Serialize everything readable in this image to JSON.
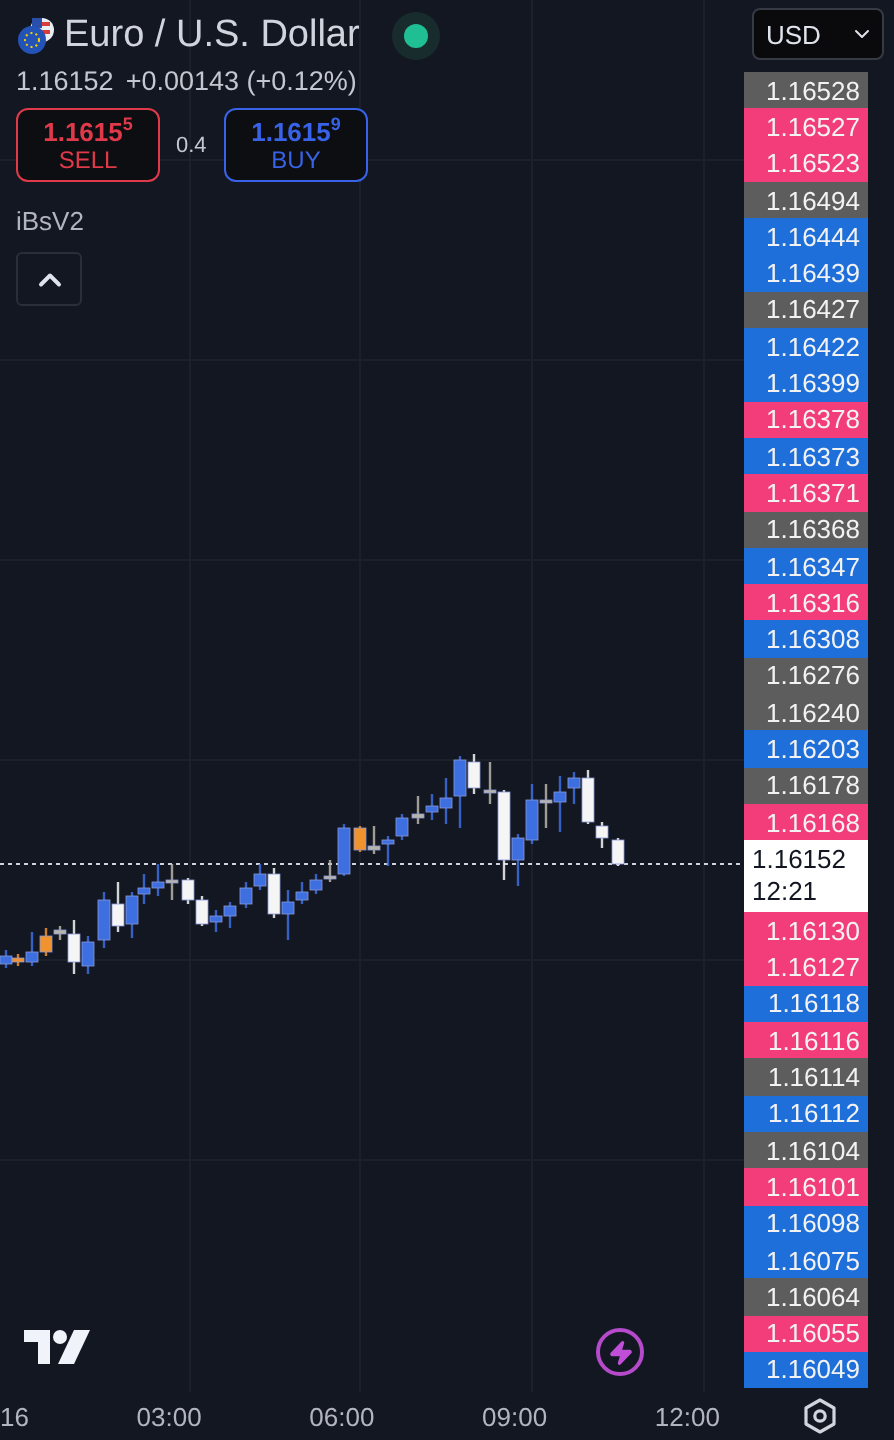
{
  "header": {
    "title": "Euro / U.S. Dollar",
    "last": "1.16152",
    "change": "+0.00143 (+0.12%)"
  },
  "trade": {
    "sell": {
      "price": "1.1615$^{5}$",
      "label": "SELL"
    },
    "spread": "0.4",
    "buy": {
      "price": "1.1615$^{9}$",
      "label": "BUY"
    }
  },
  "indicator": "iBsV2",
  "currency": "USD",
  "price_scale": [
    {
      "kind": "marker",
      "price": "1.16528",
      "color": "#5d5d5d"
    },
    {
      "kind": "marker",
      "price": "1.16527",
      "color": "#f23d7a"
    },
    {
      "kind": "marker",
      "price": "1.16523",
      "color": "#f23d7a"
    },
    {
      "kind": "marker",
      "price": "1.16494",
      "color": "#5d5d5d"
    },
    {
      "kind": "marker",
      "price": "1.16444",
      "color": "#1e6fd9"
    },
    {
      "kind": "marker",
      "price": "1.16439",
      "color": "#1e6fd9"
    },
    {
      "kind": "marker",
      "price": "1.16427",
      "color": "#5d5d5d"
    },
    {
      "kind": "marker",
      "price": "1.16422",
      "color": "#1e6fd9"
    },
    {
      "kind": "marker",
      "price": "1.16399",
      "color": "#1e6fd9"
    },
    {
      "kind": "marker",
      "price": "1.16378",
      "color": "#f23d7a"
    },
    {
      "kind": "marker",
      "price": "1.16373",
      "color": "#1e6fd9"
    },
    {
      "kind": "marker",
      "price": "1.16371",
      "color": "#f23d7a"
    },
    {
      "kind": "marker",
      "price": "1.16368",
      "color": "#5d5d5d"
    },
    {
      "kind": "marker",
      "price": "1.16347",
      "color": "#1e6fd9"
    },
    {
      "kind": "marker",
      "price": "1.16316",
      "color": "#f23d7a"
    },
    {
      "kind": "marker",
      "price": "1.16308",
      "color": "#1e6fd9"
    },
    {
      "kind": "marker",
      "price": "1.16276",
      "color": "#5d5d5d"
    },
    {
      "kind": "marker",
      "price": "1.16240",
      "color": "#5d5d5d"
    },
    {
      "kind": "marker",
      "price": "1.16203",
      "color": "#1e6fd9"
    },
    {
      "kind": "marker",
      "price": "1.16178",
      "color": "#5d5d5d"
    },
    {
      "kind": "marker",
      "price": "1.16168",
      "color": "#f23d7a"
    },
    {
      "kind": "current",
      "price": "1.16152",
      "time": "12:21"
    },
    {
      "kind": "marker",
      "price": "1.16130",
      "color": "#f23d7a"
    },
    {
      "kind": "marker",
      "price": "1.16127",
      "color": "#f23d7a"
    },
    {
      "kind": "marker",
      "price": "1.16118",
      "color": "#1e6fd9"
    },
    {
      "kind": "marker",
      "price": "1.16116",
      "color": "#f23d7a"
    },
    {
      "kind": "marker",
      "price": "1.16114",
      "color": "#5d5d5d"
    },
    {
      "kind": "marker",
      "price": "1.16112",
      "color": "#1e6fd9"
    },
    {
      "kind": "marker",
      "price": "1.16104",
      "color": "#5d5d5d"
    },
    {
      "kind": "marker",
      "price": "1.16101",
      "color": "#f23d7a"
    },
    {
      "kind": "marker",
      "price": "1.16098",
      "color": "#1e6fd9"
    },
    {
      "kind": "marker",
      "price": "1.16075",
      "color": "#1e6fd9"
    },
    {
      "kind": "marker",
      "price": "1.16064",
      "color": "#5d5d5d"
    },
    {
      "kind": "marker",
      "price": "1.16055",
      "color": "#f23d7a"
    },
    {
      "kind": "marker",
      "price": "1.16049",
      "color": "#1e6fd9"
    }
  ],
  "time_axis": [
    "16",
    "03:00",
    "06:00",
    "09:00",
    "12:00"
  ]
}
